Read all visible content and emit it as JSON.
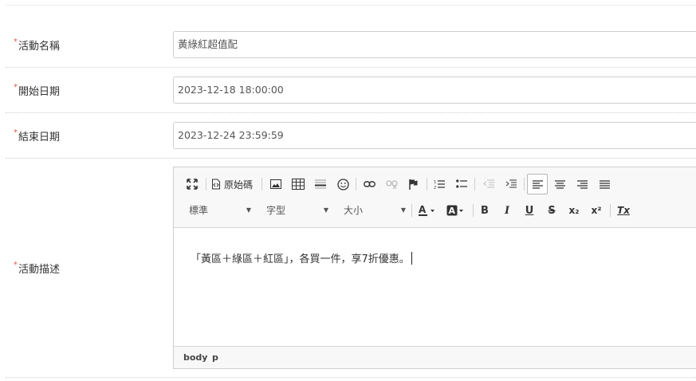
{
  "form": {
    "required_mark": "*",
    "fields": [
      {
        "label": "活動名稱",
        "value": "黃綠紅超值配"
      },
      {
        "label": "開始日期",
        "value": "2023-12-18 18:00:00"
      },
      {
        "label": "結束日期",
        "value": "2023-12-24 23:59:59"
      }
    ],
    "description_label": "活動描述"
  },
  "editor": {
    "toolbar": {
      "source_label": "原始碼",
      "format_combo": "標準",
      "font_combo": "字型",
      "size_combo": "大小",
      "bold": "B",
      "italic": "I",
      "underline": "U",
      "strike": "S",
      "subscript": "x₂",
      "superscript": "x²",
      "remove_format": "Tx"
    },
    "content_text": "「黃區＋綠區＋紅區」，各買一件，享7折優惠。",
    "path": [
      "body",
      "p"
    ]
  },
  "colors": {
    "required": "#e05a4f",
    "border": "#cfcfcf",
    "toolbar_bg": "#f8f8f8"
  }
}
